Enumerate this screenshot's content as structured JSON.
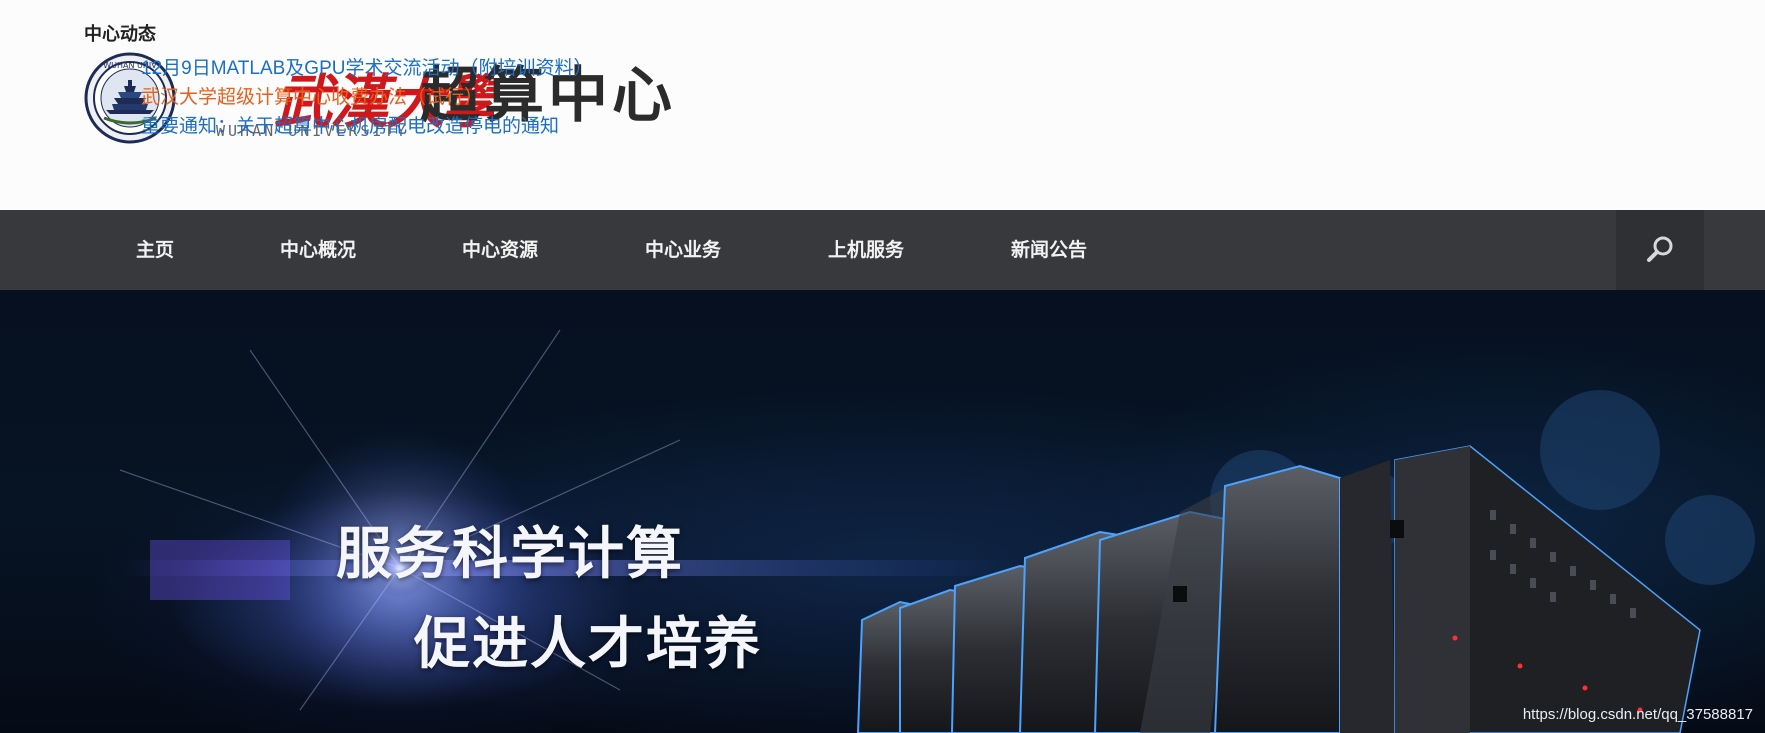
{
  "logo": {
    "institution_calligraphy": "武漢大學",
    "brand_name": "超算中心",
    "brand_sub": "WUHAN UNIVERSITY"
  },
  "news": {
    "title": "中心动态",
    "items": [
      {
        "text": "12月9日MATLAB及GPU学术交流活动（附培训资料）",
        "color": "#1c6fc4"
      },
      {
        "text": "武汉大学超级计算中心收费办法（试行）",
        "color": "#e8601c"
      },
      {
        "text": "重要通知：关于超算中心机房配电改造停电的通知",
        "color": "#1c6fc4"
      }
    ]
  },
  "nav": {
    "items": [
      {
        "label": "主页"
      },
      {
        "label": "中心概况"
      },
      {
        "label": "中心资源"
      },
      {
        "label": "中心业务"
      },
      {
        "label": "上机服务"
      },
      {
        "label": "新闻公告"
      }
    ],
    "search_icon": "search-icon"
  },
  "hero": {
    "slogan_line_1": "服务科学计算",
    "slogan_line_2": "促进人才培养"
  },
  "watermark": "https://blog.csdn.net/qq_37588817",
  "colors": {
    "nav_bg": "#37393d",
    "link_blue": "#1c6fc4",
    "link_orange": "#e8601c",
    "calligraphy_red": "#d0171b"
  }
}
